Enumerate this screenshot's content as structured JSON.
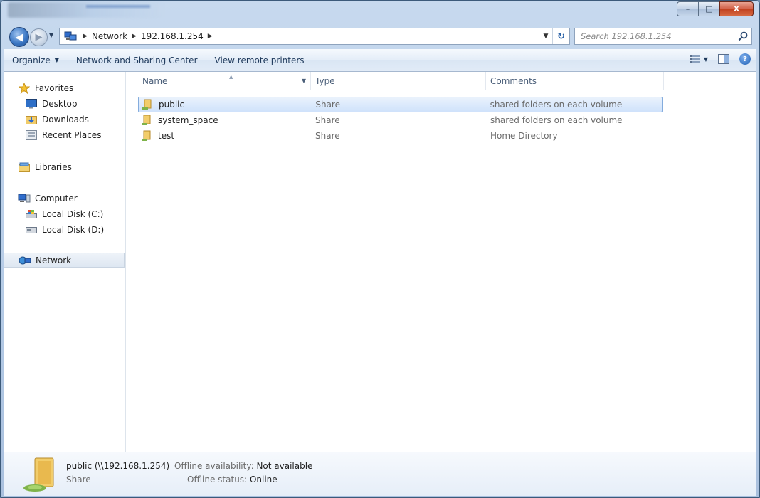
{
  "window": {
    "caption_buttons": {
      "minimize": "–",
      "maximize": "□",
      "close": "X"
    }
  },
  "address_bar": {
    "crumbs": [
      "Network",
      "192.168.1.254"
    ],
    "search_placeholder": "Search 192.168.1.254"
  },
  "command_bar": {
    "organize": "Organize",
    "network_sharing": "Network and Sharing Center",
    "view_printers": "View remote printers"
  },
  "nav_pane": {
    "favorites": "Favorites",
    "desktop": "Desktop",
    "downloads": "Downloads",
    "recent_places": "Recent Places",
    "libraries": "Libraries",
    "computer": "Computer",
    "local_disk_c": "Local Disk (C:)",
    "local_disk_d": "Local Disk (D:)",
    "network": "Network"
  },
  "columns": {
    "name": "Name",
    "type": "Type",
    "comments": "Comments"
  },
  "rows": [
    {
      "name": "public",
      "type": "Share",
      "comment": "shared folders on each volume",
      "selected": true
    },
    {
      "name": "system_space",
      "type": "Share",
      "comment": "shared folders on each volume",
      "selected": false
    },
    {
      "name": "test",
      "type": "Share",
      "comment": "Home Directory",
      "selected": false
    }
  ],
  "details": {
    "title": "public (\\\\192.168.1.254)",
    "kind": "Share",
    "availability_label": "Offline availability:",
    "availability_value": "Not available",
    "status_label": "Offline status:",
    "status_value": "Online"
  },
  "colors": {
    "selection_border": "#84acdd",
    "selection_fill": "#cfe2fb",
    "link": "#1e395b"
  }
}
